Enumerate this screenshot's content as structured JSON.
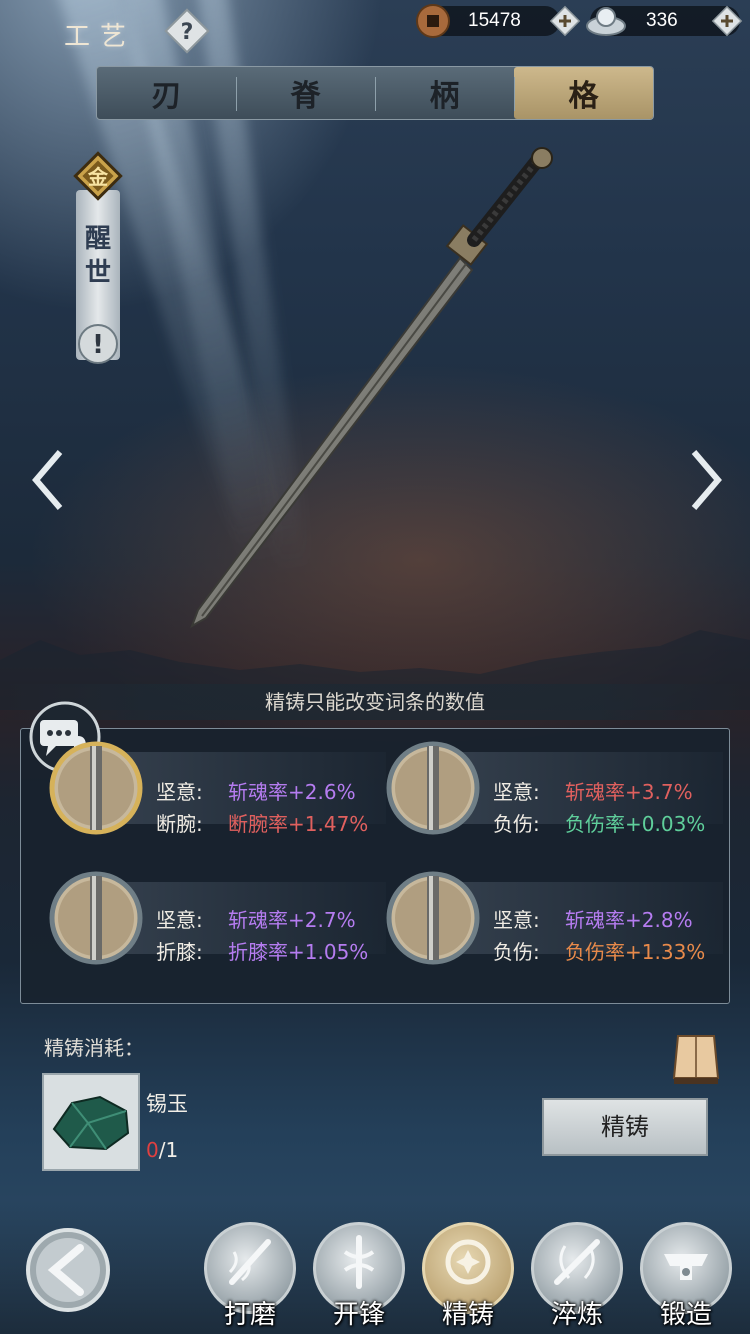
{
  "header": {
    "title": "工艺",
    "help_icon": "question-icon",
    "currency_copper": {
      "icon": "copper-coin-icon",
      "value": "15478"
    },
    "currency_silver": {
      "icon": "silver-ingot-icon",
      "value": "336"
    }
  },
  "tabs": [
    {
      "label": "刃",
      "active": false
    },
    {
      "label": "脊",
      "active": false
    },
    {
      "label": "柄",
      "active": false
    },
    {
      "label": "格",
      "active": true
    }
  ],
  "banner": {
    "rank_glyph": "金",
    "text": "醒世",
    "warn_glyph": "!"
  },
  "hint": "精铸只能改变词条的数值",
  "entries": [
    {
      "row1_label": "坚意:",
      "row1_value": "斩魂率+2.6%",
      "row1_color": "purple",
      "row2_label": "断腕:",
      "row2_value": "断腕率+1.47%",
      "row2_color": "red",
      "selected": true
    },
    {
      "row1_label": "坚意:",
      "row1_value": "斩魂率+3.7%",
      "row1_color": "red",
      "row2_label": "负伤:",
      "row2_value": "负伤率+0.03%",
      "row2_color": "green",
      "selected": false
    },
    {
      "row1_label": "坚意:",
      "row1_value": "斩魂率+2.7%",
      "row1_color": "purple",
      "row2_label": "折膝:",
      "row2_value": "折膝率+1.05%",
      "row2_color": "purple",
      "selected": false
    },
    {
      "row1_label": "坚意:",
      "row1_value": "斩魂率+2.8%",
      "row1_color": "purple",
      "row2_label": "负伤:",
      "row2_value": "负伤率+1.33%",
      "row2_color": "orange",
      "selected": false
    }
  ],
  "cost": {
    "label": "精铸消耗：",
    "item_name": "锡玉",
    "owned": "0",
    "required": "/1"
  },
  "refine_button": "精铸",
  "nav": [
    {
      "label": "打磨",
      "icon": "grind-icon",
      "active": false
    },
    {
      "label": "开锋",
      "icon": "sharpen-icon",
      "active": false
    },
    {
      "label": "精铸",
      "icon": "refine-icon",
      "active": true
    },
    {
      "label": "淬炼",
      "icon": "temper-icon",
      "active": false
    },
    {
      "label": "锻造",
      "icon": "forge-icon",
      "active": false
    }
  ],
  "colors": {
    "purple": "#b57cf0",
    "red": "#e0605e",
    "green": "#5fcf9b",
    "orange": "#e88a4a",
    "gold": "#cdb88c"
  }
}
